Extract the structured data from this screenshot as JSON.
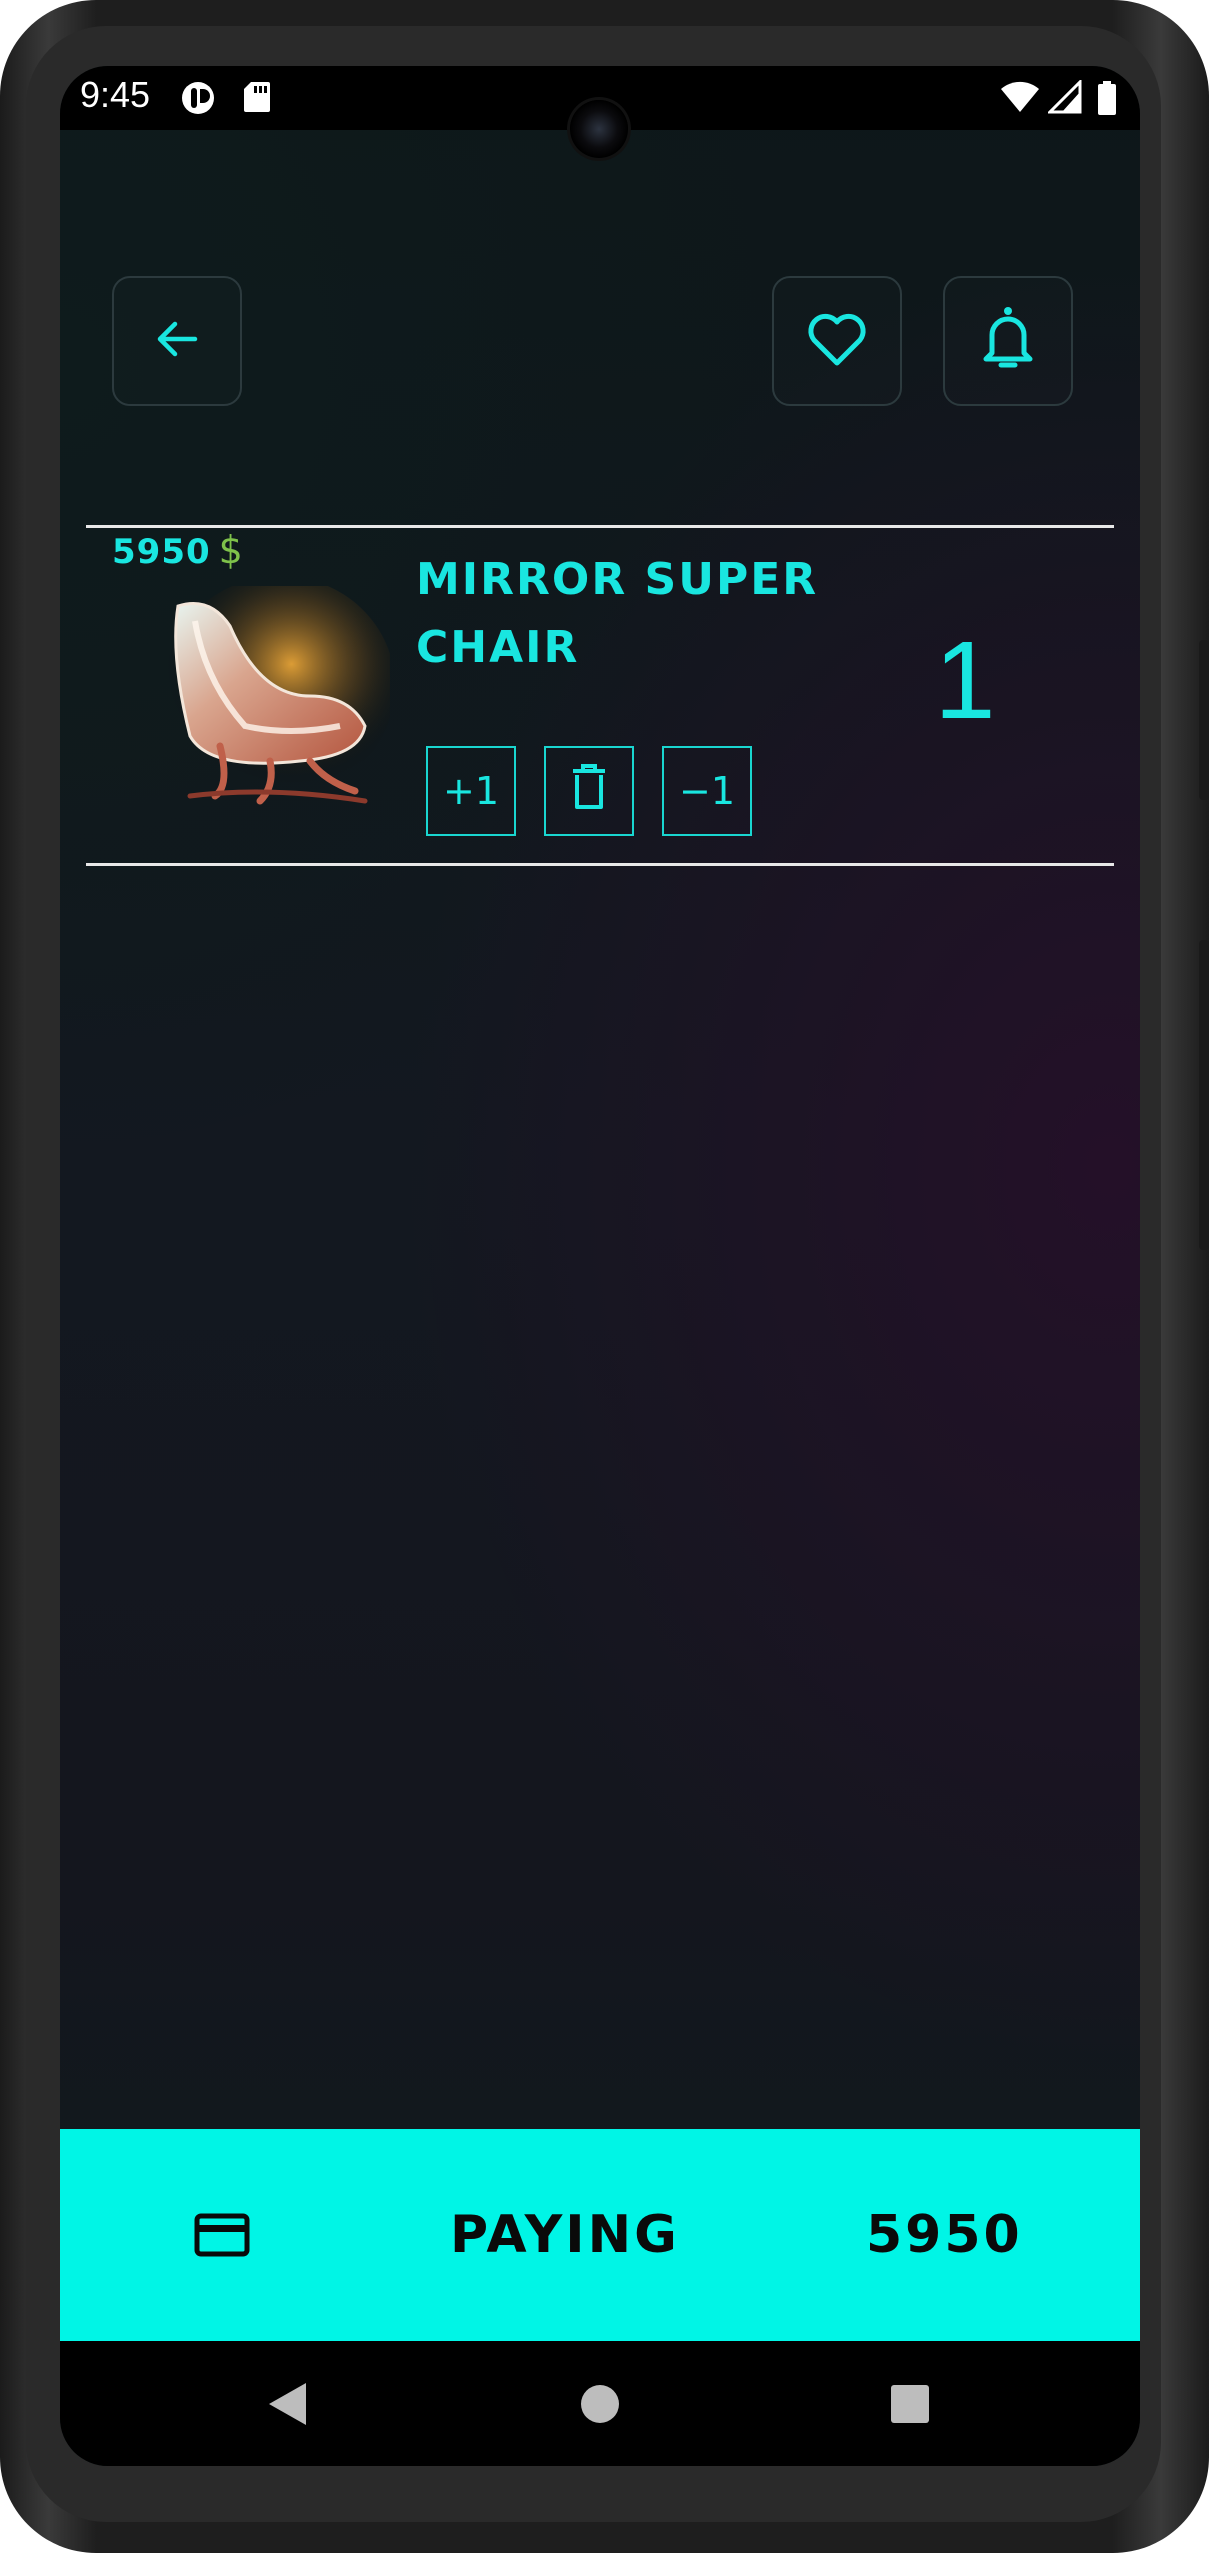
{
  "status_bar": {
    "time": "9:45"
  },
  "header": {
    "back": "arrow-back-icon",
    "favorite": "heart-icon",
    "notifications": "bell-icon"
  },
  "cart": {
    "items": [
      {
        "price": "5950",
        "currency": "$",
        "name": "MIRROR SUPER CHAIR",
        "quantity": "1",
        "increment_label": "+1",
        "decrement_label": "−1",
        "delete": "trash-icon"
      }
    ]
  },
  "pay_bar": {
    "icon": "credit-card-icon",
    "label": "PAYING",
    "total": "5950"
  },
  "colors": {
    "accent": "#19e6e0",
    "pay_bar": "#00f5e6",
    "currency": "#7ec24a"
  }
}
